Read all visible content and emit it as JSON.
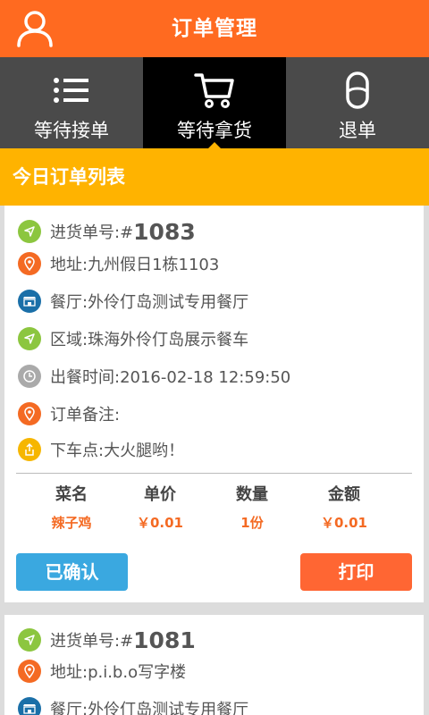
{
  "header": {
    "title": "订单管理"
  },
  "tabs": [
    {
      "label": "等待接单",
      "icon": "list-icon",
      "active": false
    },
    {
      "label": "等待拿货",
      "icon": "cart-icon",
      "active": true
    },
    {
      "label": "退单",
      "icon": "return-icon",
      "active": false
    }
  ],
  "section": {
    "title": "今日订单列表"
  },
  "orders": [
    {
      "number_label": "进货单号:#",
      "number": "1083",
      "address": "地址:九州假日1栋1103",
      "restaurant": "餐厅:外伶仃岛测试专用餐厅",
      "area": "区域:珠海外伶仃岛展示餐车",
      "meal_time": "出餐时间:2016-02-18 12:59:50",
      "remark": "订单备注:",
      "dropoff": "下车点:大火腿哟！",
      "table": {
        "headers": [
          "菜名",
          "单价",
          "数量",
          "金额"
        ],
        "rows": [
          [
            "辣子鸡",
            "￥0.01",
            "1份",
            "￥0.01"
          ]
        ]
      },
      "confirm_label": "已确认",
      "print_label": "打印"
    },
    {
      "number_label": "进货单号:#",
      "number": "1081",
      "address": "地址:p.i.b.o写字楼",
      "restaurant": "餐厅:外伶仃岛测试专用餐厅"
    }
  ],
  "colors": {
    "header": "#ff6a20",
    "tab_bar": "#4a4a4a",
    "tab_active": "#000000",
    "section_bar": "#ffb300",
    "confirm_button": "#3aa8e0",
    "print_button": "#ff6633",
    "price_text": "#f46a23"
  }
}
